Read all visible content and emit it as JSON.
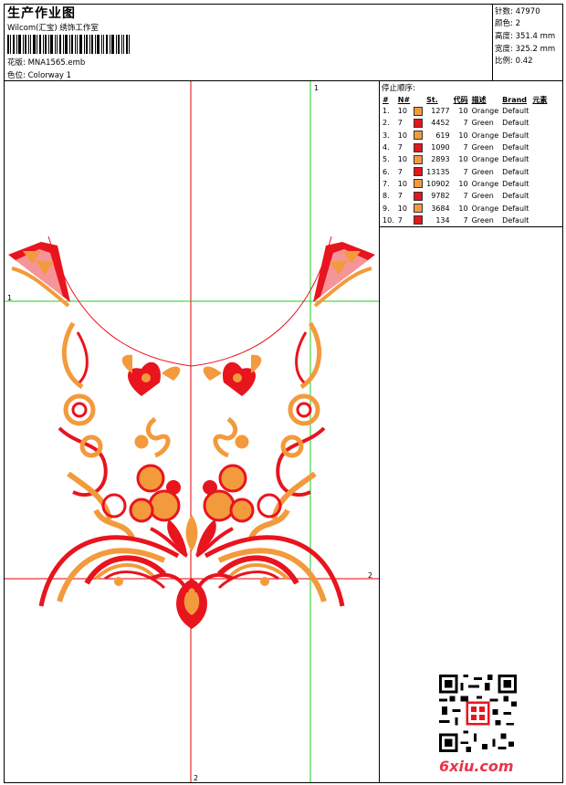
{
  "header": {
    "title": "生产作业图",
    "subtitle": "Wilcom(汇宝) 绣饰工作室",
    "design_label": "花版:",
    "design_value": "MNA1565.emb",
    "colorway_label": "色位:",
    "colorway_value": "Colorway 1"
  },
  "stats": [
    {
      "label": "针数:",
      "value": "47970"
    },
    {
      "label": "颜色:",
      "value": "2"
    },
    {
      "label": "高度:",
      "value": "351.4 mm"
    },
    {
      "label": "宽度:",
      "value": "325.2 mm"
    },
    {
      "label": "比例:",
      "value": "0.42"
    }
  ],
  "stop_sequence": {
    "title": "停止顺序:",
    "columns": [
      "#",
      "N#",
      "St.",
      "代码",
      "描述",
      "Brand",
      "元素"
    ],
    "rows": [
      {
        "idx": "1.",
        "n": "10",
        "color": "#f39a3c",
        "st": "1277",
        "code": "10",
        "desc": "Orange",
        "brand": "Default"
      },
      {
        "idx": "2.",
        "n": "7",
        "color": "#e8141e",
        "st": "4452",
        "code": "7",
        "desc": "Green",
        "brand": "Default"
      },
      {
        "idx": "3.",
        "n": "10",
        "color": "#f39a3c",
        "st": "619",
        "code": "10",
        "desc": "Orange",
        "brand": "Default"
      },
      {
        "idx": "4.",
        "n": "7",
        "color": "#e8141e",
        "st": "1090",
        "code": "7",
        "desc": "Green",
        "brand": "Default"
      },
      {
        "idx": "5.",
        "n": "10",
        "color": "#f39a3c",
        "st": "2893",
        "code": "10",
        "desc": "Orange",
        "brand": "Default"
      },
      {
        "idx": "6.",
        "n": "7",
        "color": "#e8141e",
        "st": "13135",
        "code": "7",
        "desc": "Green",
        "brand": "Default"
      },
      {
        "idx": "7.",
        "n": "10",
        "color": "#f39a3c",
        "st": "10902",
        "code": "10",
        "desc": "Orange",
        "brand": "Default"
      },
      {
        "idx": "8.",
        "n": "7",
        "color": "#e8141e",
        "st": "9782",
        "code": "7",
        "desc": "Green",
        "brand": "Default"
      },
      {
        "idx": "9.",
        "n": "10",
        "color": "#f39a3c",
        "st": "3684",
        "code": "10",
        "desc": "Orange",
        "brand": "Default"
      },
      {
        "idx": "10.",
        "n": "7",
        "color": "#e8141e",
        "st": "134",
        "code": "7",
        "desc": "Green",
        "brand": "Default"
      }
    ]
  },
  "guides": {
    "v1": "1",
    "h1": "1",
    "h2": "2",
    "v2": "2"
  },
  "colors": {
    "orange": "#f39a3c",
    "red": "#e8141e",
    "guide_red": "#e00000",
    "guide_green": "#22cc22"
  },
  "watermark": "6xiu.com",
  "icons": [
    "barcode-icon",
    "qr-code-icon",
    "seal-stamp-icon"
  ]
}
